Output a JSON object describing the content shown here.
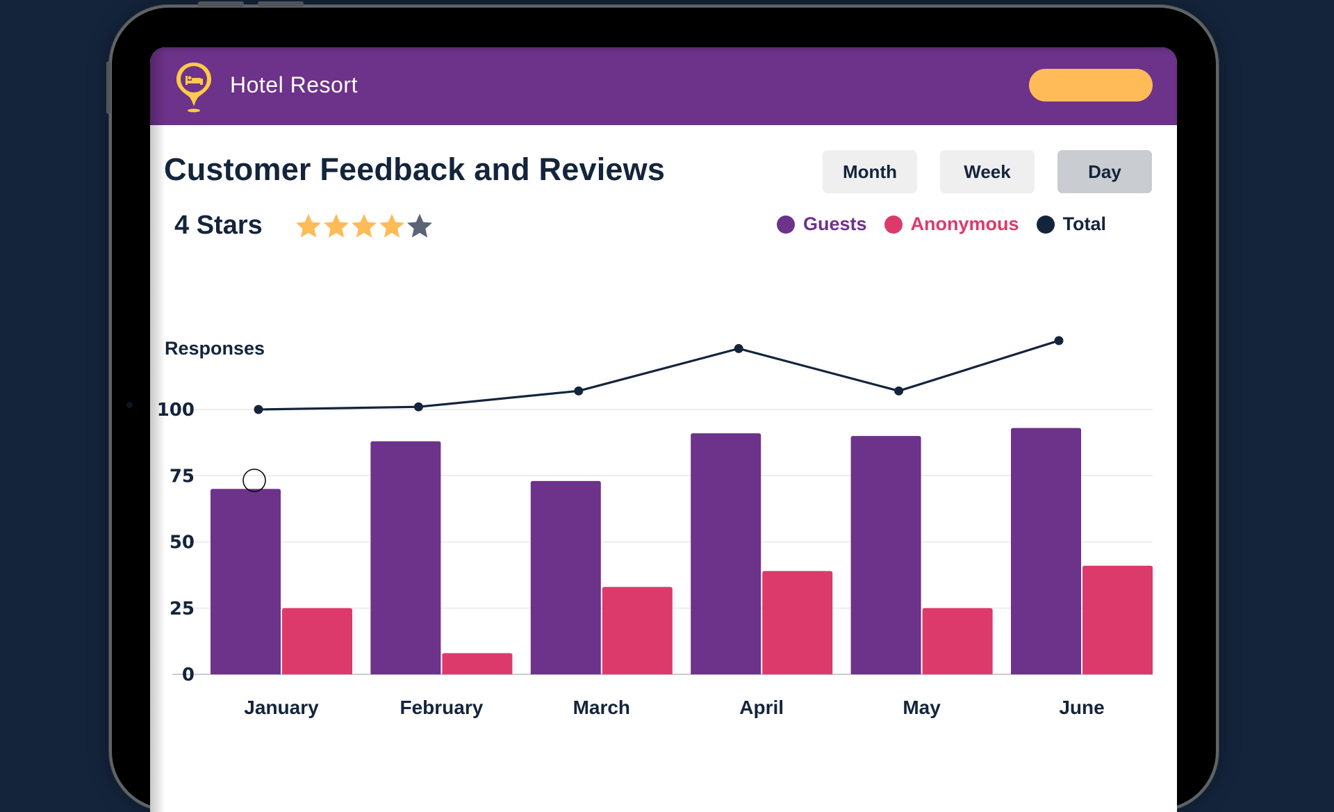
{
  "app": {
    "brand_name": "Hotel Resort",
    "logo_icon": "hotel-location-pin-icon",
    "cta_label": ""
  },
  "page": {
    "title": "Customer Feedback and Reviews",
    "rating_label": "4 Stars",
    "rating_value": 4,
    "rating_max": 5
  },
  "period_buttons": [
    {
      "label": "Month",
      "active": false
    },
    {
      "label": "Week",
      "active": false
    },
    {
      "label": "Day",
      "active": true
    }
  ],
  "colors": {
    "brand_purple": "#6d3289",
    "accent_yellow": "#ffbb58",
    "guests": "#6d3289",
    "anonymous": "#dc3a6b",
    "total": "#14243b",
    "star_on": "#ffbb58",
    "star_off": "#5a6475"
  },
  "chart_data": {
    "type": "bar",
    "title": "",
    "xlabel": "",
    "ylabel": "Responses",
    "categories": [
      "January",
      "February",
      "March",
      "April",
      "May",
      "June"
    ],
    "yticks": [
      0,
      25,
      50,
      75,
      100
    ],
    "ylim": [
      0,
      100
    ],
    "grid": true,
    "legend_position": "top-right",
    "series": [
      {
        "name": "Guests",
        "type": "bar",
        "color": "#6d3289",
        "values": [
          70,
          88,
          73,
          91,
          90,
          93
        ]
      },
      {
        "name": "Anonymous",
        "type": "bar",
        "color": "#dc3a6b",
        "values": [
          25,
          8,
          33,
          39,
          25,
          41
        ]
      },
      {
        "name": "Total",
        "type": "line",
        "color": "#14243b",
        "values": [
          100,
          101,
          107,
          123,
          107,
          126
        ]
      }
    ]
  }
}
